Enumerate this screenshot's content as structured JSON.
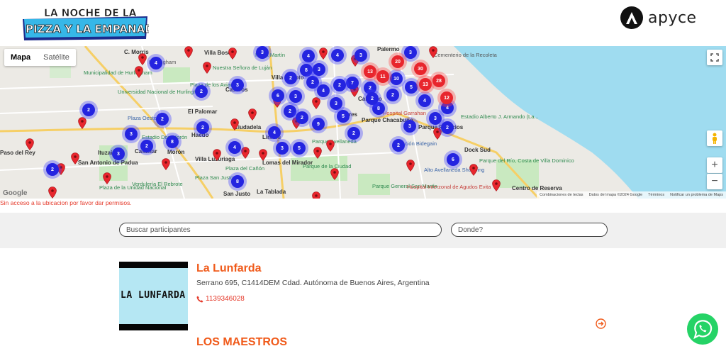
{
  "header": {
    "event_logo_line1": "LA NOCHE DE LA",
    "event_logo_line2": "PIZZA Y LA EMPANADA",
    "sponsor_name": "apyce"
  },
  "map": {
    "type_controls": [
      "Mapa",
      "Satélite"
    ],
    "active_type": "Mapa",
    "fullscreen_icon": "fullscreen-icon",
    "pegman_icon": "pegman-icon",
    "zoom_in": "+",
    "zoom_out": "−",
    "google_logo": "Google",
    "attribution": [
      "Combinaciones de teclas",
      "Datos del mapa ©2024 Google",
      "Términos",
      "Notificar un problema de Maps"
    ],
    "labels": [
      {
        "t": "Villa Bosch"
      },
      {
        "t": "C. Morris"
      },
      {
        "t": "Hurlingham"
      },
      {
        "t": "Municipalidad de Hurlingham"
      },
      {
        "t": "Universidad Nacional de Hurlingham"
      },
      {
        "t": "Nuestra Señora de Luján"
      },
      {
        "t": "Plaza de los Aviadores"
      },
      {
        "t": "Caseros"
      },
      {
        "t": "El Palomar"
      },
      {
        "t": "Plaza Oeste"
      },
      {
        "t": "Estadio Don Morón"
      },
      {
        "t": "Haedo"
      },
      {
        "t": "Paso del Rey"
      },
      {
        "t": "Ituzaingó"
      },
      {
        "t": "Castelar"
      },
      {
        "t": "Morón"
      },
      {
        "t": "San Antonio de Padua"
      },
      {
        "t": "Verdulería El Rebrote"
      },
      {
        "t": "Plaza de la Unidad Nacional"
      },
      {
        "t": "Villa Luzuriaga"
      },
      {
        "t": "Plaza del Cañón"
      },
      {
        "t": "Plaza San Justo"
      },
      {
        "t": "San Justo"
      },
      {
        "t": "Lomas del Mirador"
      },
      {
        "t": "La Tablada"
      },
      {
        "t": "Parque de la Ciudad"
      },
      {
        "t": "Parque General San Martín"
      },
      {
        "t": "Parque Chacabuco"
      },
      {
        "t": "Caballito"
      },
      {
        "t": "Flores"
      },
      {
        "t": "Liniers"
      },
      {
        "t": "Villa Devoto"
      },
      {
        "t": "Palermo"
      },
      {
        "t": "Cementerio de la Recoleta"
      },
      {
        "t": "Estadio Alberto J. Armando (La..."
      },
      {
        "t": "Dock Sud"
      },
      {
        "t": "Parque del Río, Costa de Villa Dominico"
      },
      {
        "t": "Centro de Reserva"
      },
      {
        "t": "Alto Avellaneda Shopping"
      },
      {
        "t": "Hospital Interzonal de Agudos Evita"
      },
      {
        "t": "Hospital Garrahan"
      },
      {
        "t": "Estación Bidegain"
      },
      {
        "t": "Plaza Martín"
      },
      {
        "t": "Ciudadela"
      },
      {
        "t": "Parque Avellaneda"
      },
      {
        "t": "Parque Patricios"
      }
    ],
    "clusters": [
      {
        "n": "4"
      },
      {
        "n": "2"
      },
      {
        "n": "2"
      },
      {
        "n": "2"
      },
      {
        "n": "3"
      },
      {
        "n": "3"
      },
      {
        "n": "2"
      },
      {
        "n": "8"
      },
      {
        "n": "2"
      },
      {
        "n": "3"
      },
      {
        "n": "2"
      },
      {
        "n": "4"
      },
      {
        "n": "4"
      },
      {
        "n": "8"
      },
      {
        "n": "3"
      },
      {
        "n": "5"
      },
      {
        "n": "4"
      },
      {
        "n": "8"
      },
      {
        "n": "2"
      },
      {
        "n": "2"
      },
      {
        "n": "6"
      },
      {
        "n": "2"
      },
      {
        "n": "3"
      },
      {
        "n": "4"
      },
      {
        "n": "2"
      },
      {
        "n": "7"
      },
      {
        "n": "9"
      },
      {
        "n": "3"
      },
      {
        "n": "10"
      },
      {
        "n": "5"
      },
      {
        "n": "2"
      },
      {
        "n": "4"
      },
      {
        "n": "2"
      },
      {
        "n": "5"
      },
      {
        "n": "2"
      },
      {
        "n": "3"
      },
      {
        "n": "8"
      },
      {
        "n": "2"
      },
      {
        "n": "3"
      },
      {
        "n": "4"
      },
      {
        "n": "3"
      },
      {
        "n": "3"
      },
      {
        "n": "2"
      },
      {
        "n": "2"
      },
      {
        "n": "6"
      },
      {
        "n": "3"
      },
      {
        "n": "4"
      },
      {
        "n": "2"
      },
      {
        "n": "3"
      }
    ],
    "red_clusters": [
      {
        "n": "13"
      },
      {
        "n": "11"
      },
      {
        "n": "20"
      },
      {
        "n": "30"
      },
      {
        "n": "13"
      },
      {
        "n": "28"
      },
      {
        "n": "12"
      }
    ]
  },
  "geolocation_message": "Sin acceso a la ubicacion por favor dar permisos.",
  "search": {
    "participants_placeholder": "Buscar participantes",
    "where_placeholder": "Donde?"
  },
  "listings": [
    {
      "name": "La Lunfarda",
      "image_text": "LA LUNFARDA",
      "address": "Serrano 695, C1414DEM Cdad. Autónoma de Buenos Aires, Argentina",
      "phone": "1139346028",
      "phone_icon": "phone-icon",
      "more_icon": "arrow-right-circle-icon"
    },
    {
      "name": "LOS MAESTROS"
    }
  ],
  "floating": {
    "whatsapp_icon": "whatsapp-icon"
  },
  "colors": {
    "accent": "#f05a1a",
    "link_red": "#e53a2b",
    "cluster_blue": "#2424e0",
    "cluster_red": "#e8262d",
    "water": "#9fdcf0",
    "whatsapp": "#25d366"
  }
}
